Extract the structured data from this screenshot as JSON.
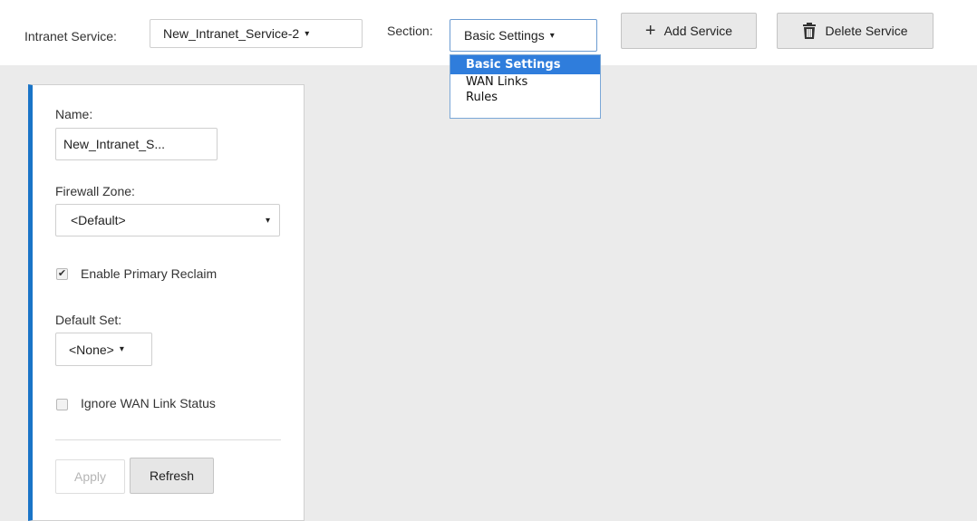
{
  "toolbar": {
    "intranet_service_label": "Intranet Service:",
    "intranet_service_value": "New_Intranet_Service-2",
    "section_label": "Section:",
    "section_value": "Basic Settings",
    "caret": "▾",
    "add_service_label": "Add Service",
    "add_icon": "+",
    "delete_service_label": "Delete Service"
  },
  "section_dropdown": {
    "options": [
      "Basic Settings",
      "WAN Links",
      "Rules"
    ]
  },
  "form": {
    "name_label": "Name:",
    "name_value": "New_Intranet_S...",
    "firewall_zone_label": "Firewall Zone:",
    "firewall_zone_value": "<Default>",
    "enable_primary_reclaim_label": "Enable Primary Reclaim",
    "enable_primary_reclaim_checked": true,
    "checkmark": "✔",
    "default_set_label": "Default Set:",
    "default_set_value": "<None>",
    "ignore_wan_link_status_label": "Ignore WAN Link Status",
    "ignore_wan_link_status_checked": false,
    "apply_label": "Apply",
    "refresh_label": "Refresh"
  },
  "colors": {
    "accent_blue": "#1a74c7",
    "dropdown_selected": "#2f7ddc",
    "workspace_bg": "#ebebeb"
  }
}
